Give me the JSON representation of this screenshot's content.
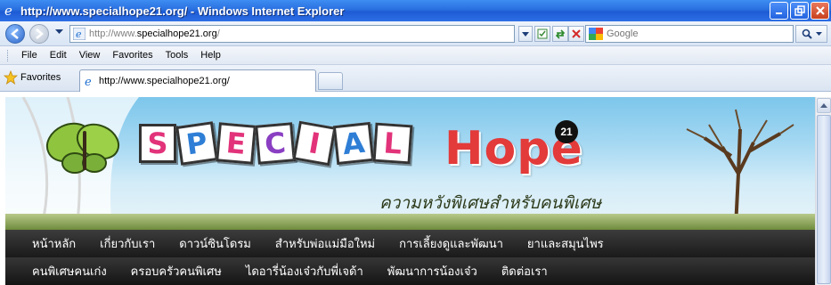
{
  "window": {
    "title": "http://www.specialhope21.org/ - Windows Internet Explorer"
  },
  "address": {
    "url_prefix": "http://www.",
    "url_domain": "specialhope21.org",
    "url_suffix": "/"
  },
  "search": {
    "placeholder": "Google"
  },
  "menu": {
    "items": [
      "File",
      "Edit",
      "View",
      "Favorites",
      "Tools",
      "Help"
    ]
  },
  "favorites_bar": {
    "favorites_label": "Favorites",
    "tab_title": "http://www.specialhope21.org/"
  },
  "site": {
    "logo_letters": [
      "S",
      "P",
      "E",
      "C",
      "I",
      "A",
      "L"
    ],
    "logo_word": "Hope",
    "logo_badge": "21",
    "slogan": "ความหวังพิเศษสำหรับคนพิเศษ",
    "nav_row1": [
      "หน้าหลัก",
      "เกี่ยวกับเรา",
      "ดาวน์ซินโดรม",
      "สำหรับพ่อแม่มือใหม่",
      "การเลี้ยงดูและพัฒนา",
      "ยาและสมุนไพร"
    ],
    "nav_row2": [
      "คนพิเศษคนเก่ง",
      "ครอบครัวคนพิเศษ",
      "ไดอารี่น้องเจ๋วกับพี่เจด้า",
      "พัฒนาการน้องเจ๋ว",
      "ติดต่อเรา"
    ]
  },
  "colors": {
    "titlebar": "#2a6fe0",
    "hope_red": "#e33a3a",
    "nav_bg": "#1a1a1a"
  }
}
